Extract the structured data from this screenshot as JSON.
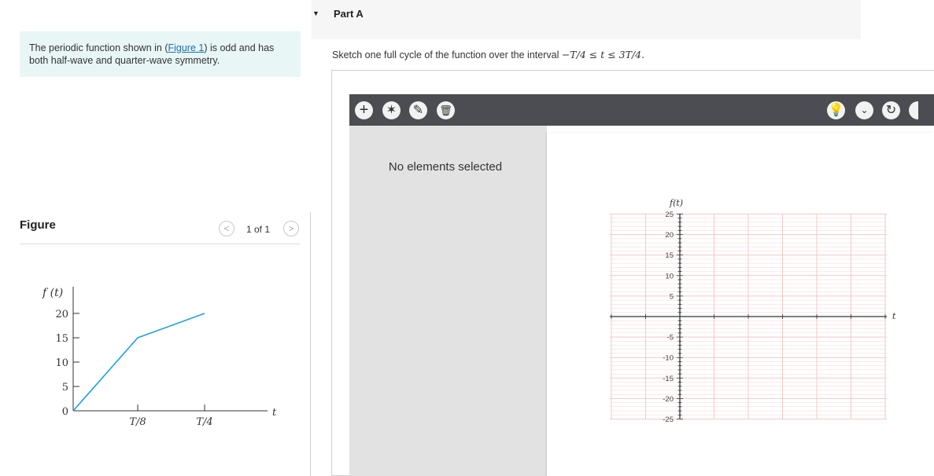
{
  "problem": {
    "text_before": "The periodic function shown in (",
    "link": "Figure 1",
    "text_after": ") is odd and has both half-wave and quarter-wave symmetry."
  },
  "figure": {
    "label": "Figure",
    "page": "1 of 1",
    "prev_icon": "chevron-left-icon",
    "next_icon": "chevron-right-icon",
    "prev_glyph": "<",
    "next_glyph": ">",
    "ylabel": "f (t)",
    "xlabel": "t",
    "yticks": [
      "0",
      "5",
      "10",
      "15",
      "20"
    ],
    "xticks": [
      "T/8",
      "T/4"
    ],
    "line_color": "#1a9ee0"
  },
  "chart_data": [
    {
      "type": "line",
      "title": "",
      "xlabel": "t",
      "ylabel": "f (t)",
      "x": [
        "0",
        "T/8",
        "T/4"
      ],
      "values": [
        0,
        15,
        20
      ],
      "ylim": [
        0,
        20
      ],
      "yticks": [
        0,
        5,
        10,
        15,
        20
      ],
      "grid": false
    },
    {
      "type": "scatter",
      "title": "",
      "xlabel": "t",
      "ylabel": "f(t)",
      "series": [],
      "ylim": [
        -25,
        25
      ],
      "yticks": [
        -25,
        -20,
        -15,
        -10,
        -5,
        5,
        10,
        15,
        20,
        25
      ],
      "grid": true,
      "grid_color": "#f2c9c9"
    }
  ],
  "part": {
    "toggle": "▼",
    "title": "Part A",
    "question_before": "Sketch one full cycle of the function over the interval ",
    "question_math": "−T/4 ≤ t ≤ 3T/4."
  },
  "toolbar": {
    "add_glyph": "+",
    "line_glyph": "✶",
    "edit_glyph": "✎",
    "delete_glyph": "🗑",
    "hint_glyph": "💡",
    "menu_glyph": "⌄",
    "redo_glyph": "↻",
    "icons": [
      "plus-icon",
      "line-tool-icon",
      "edit-point-icon",
      "trash-icon",
      "hint-bulb-icon",
      "chevron-down-icon",
      "redo-icon"
    ]
  },
  "panel": {
    "empty_message": "No elements selected"
  },
  "graph": {
    "ylabel": "f(t)",
    "xlabel": "t",
    "yticks": [
      "25",
      "20",
      "15",
      "10",
      "5",
      "-5",
      "-10",
      "-15",
      "-20",
      "-25"
    ]
  },
  "colors": {
    "problem_bg": "#e8f6f6",
    "toolbar_bg": "#4b4d52",
    "panel_bg": "#e2e2e2",
    "grid": "#f2c9c9",
    "link": "#1a6fb0"
  }
}
